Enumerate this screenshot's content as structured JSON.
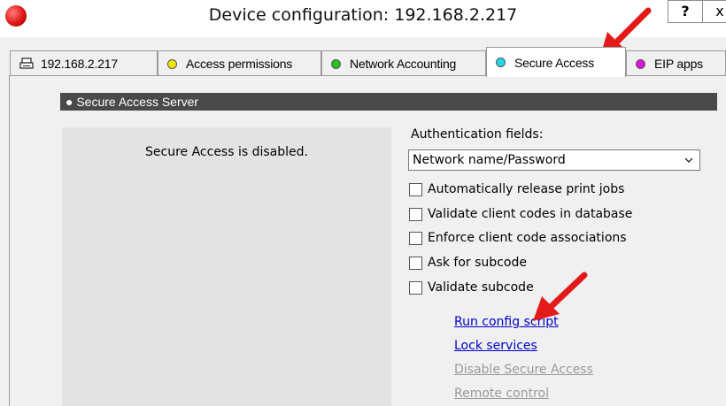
{
  "window": {
    "title": "Device configuration: 192.168.2.217",
    "help_button": "?",
    "close_button": "x"
  },
  "tabs": [
    {
      "label": "192.168.2.217",
      "icon": "printer-icon"
    },
    {
      "label": "Access permissions",
      "icon": "yellow-dot-icon",
      "color": "#f2e600"
    },
    {
      "label": "Network Accounting",
      "icon": "green-dot-icon",
      "color": "#21c21c"
    },
    {
      "label": "Secure Access",
      "icon": "cyan-dot-icon",
      "color": "#22d7e8",
      "active": true
    },
    {
      "label": "EIP apps",
      "icon": "magenta-dot-icon",
      "color": "#e010e0"
    }
  ],
  "section": {
    "header": "● Secure Access Server"
  },
  "status": {
    "text": "Secure Access is disabled."
  },
  "auth": {
    "label": "Authentication fields:",
    "selected": "Network name/Password"
  },
  "options": [
    {
      "label": "Automatically release print jobs",
      "checked": false
    },
    {
      "label": "Validate client codes in database",
      "checked": false
    },
    {
      "label": "Enforce client code associations",
      "checked": false
    },
    {
      "label": "Ask for subcode",
      "checked": false
    },
    {
      "label": "Validate subcode",
      "checked": false
    }
  ],
  "links": [
    {
      "label": "Run config script",
      "enabled": true
    },
    {
      "label": "Lock services",
      "enabled": true
    },
    {
      "label": "Disable Secure Access",
      "enabled": false
    },
    {
      "label": "Remote control",
      "enabled": false
    }
  ],
  "colors": {
    "annotation_arrow": "#e31a1a",
    "link_enabled": "#0000cc",
    "link_disabled": "#9a9a9a",
    "header_bg": "#4a4a4a"
  }
}
